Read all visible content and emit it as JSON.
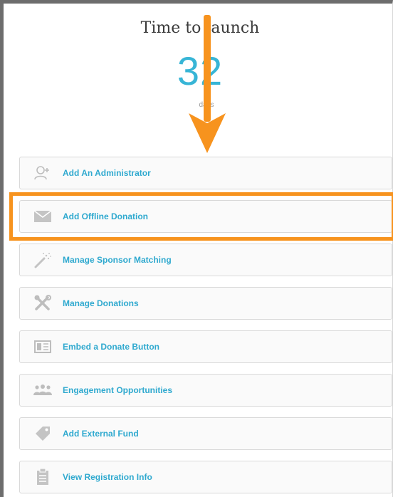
{
  "launch": {
    "title": "Time to launch",
    "count": "32",
    "unit": "days"
  },
  "menu": {
    "items": [
      {
        "label": "Add An Administrator",
        "icon": "add-user-icon"
      },
      {
        "label": "Add Offline Donation",
        "icon": "envelope-icon"
      },
      {
        "label": "Manage Sponsor Matching",
        "icon": "magic-wand-icon"
      },
      {
        "label": "Manage Donations",
        "icon": "tools-icon"
      },
      {
        "label": "Embed a Donate Button",
        "icon": "embed-card-icon"
      },
      {
        "label": "Engagement Opportunities",
        "icon": "people-group-icon"
      },
      {
        "label": "Add External Fund",
        "icon": "tag-icon"
      },
      {
        "label": "View Registration Info",
        "icon": "clipboard-icon"
      }
    ]
  },
  "annotation": {
    "highlight_color": "#f7931e",
    "highlighted_item": "Add Offline Donation"
  },
  "colors": {
    "accent": "#37b5d6",
    "link": "#2fa9cf",
    "highlight": "#f7931e"
  }
}
